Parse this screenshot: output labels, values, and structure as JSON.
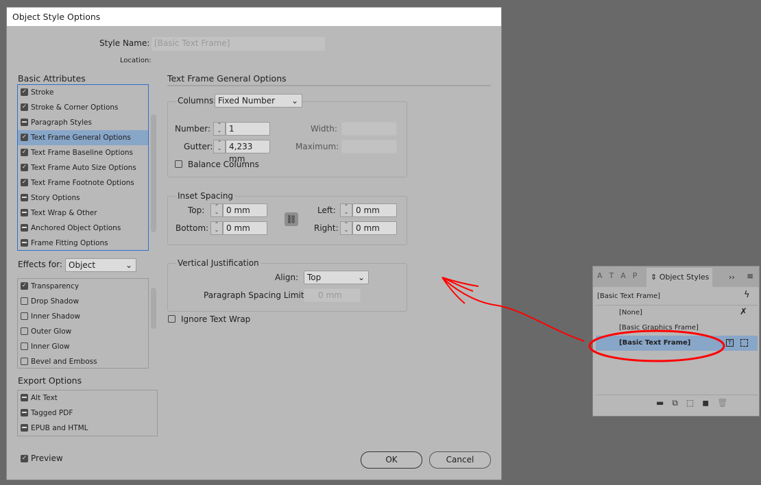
{
  "dialog": {
    "title": "Object Style Options",
    "style_name_label": "Style Name:",
    "style_name_value": "[Basic Text Frame]",
    "location_label": "Location:"
  },
  "basic": {
    "heading": "Basic Attributes",
    "items": [
      {
        "label": "Stroke",
        "state": "on"
      },
      {
        "label": "Stroke & Corner Options",
        "state": "on"
      },
      {
        "label": "Paragraph Styles",
        "state": "mix"
      },
      {
        "label": "Text Frame General Options",
        "state": "on",
        "selected": true
      },
      {
        "label": "Text Frame Baseline Options",
        "state": "on"
      },
      {
        "label": "Text Frame Auto Size Options",
        "state": "on"
      },
      {
        "label": "Text Frame Footnote Options",
        "state": "on"
      },
      {
        "label": "Story Options",
        "state": "mix"
      },
      {
        "label": "Text Wrap & Other",
        "state": "mix"
      },
      {
        "label": "Anchored Object Options",
        "state": "mix"
      },
      {
        "label": "Frame Fitting Options",
        "state": "mix"
      }
    ]
  },
  "effects": {
    "label": "Effects for:",
    "target": "Object",
    "items": [
      {
        "label": "Transparency",
        "state": "on"
      },
      {
        "label": "Drop Shadow",
        "state": "off"
      },
      {
        "label": "Inner Shadow",
        "state": "off"
      },
      {
        "label": "Outer Glow",
        "state": "off"
      },
      {
        "label": "Inner Glow",
        "state": "off"
      },
      {
        "label": "Bevel and Emboss",
        "state": "off"
      }
    ]
  },
  "export": {
    "heading": "Export Options",
    "items": [
      {
        "label": "Alt Text",
        "state": "mix"
      },
      {
        "label": "Tagged PDF",
        "state": "mix"
      },
      {
        "label": "EPUB and HTML",
        "state": "mix"
      }
    ]
  },
  "preview": {
    "label": "Preview",
    "checked": true
  },
  "main": {
    "heading": "Text Frame General Options",
    "columns": {
      "label": "Columns:",
      "value": "Fixed Number",
      "number_label": "Number:",
      "number": "1",
      "gutter_label": "Gutter:",
      "gutter": "4,233 mm",
      "width_label": "Width:",
      "maximum_label": "Maximum:",
      "balance_label": "Balance Columns"
    },
    "inset": {
      "heading": "Inset Spacing",
      "top_label": "Top:",
      "top": "0 mm",
      "bottom_label": "Bottom:",
      "bottom": "0 mm",
      "left_label": "Left:",
      "left": "0 mm",
      "right_label": "Right:",
      "right": "0 mm"
    },
    "vj": {
      "heading": "Vertical Justification",
      "align_label": "Align:",
      "align": "Top",
      "psl_label": "Paragraph Spacing Limit:",
      "psl": "0 mm"
    },
    "ignore_wrap": "Ignore Text Wrap"
  },
  "buttons": {
    "ok": "OK",
    "cancel": "Cancel"
  },
  "panel": {
    "tabs": [
      "A",
      "T",
      "A",
      "P"
    ],
    "active_tab": "Object Styles",
    "more": "››",
    "current": "[Basic Text Frame]",
    "styles": [
      "[None]",
      "[Basic Graphics Frame]",
      "[Basic Text Frame]"
    ]
  },
  "colors": {
    "annotation": "#ff0000",
    "selection": "#88a6c8"
  }
}
